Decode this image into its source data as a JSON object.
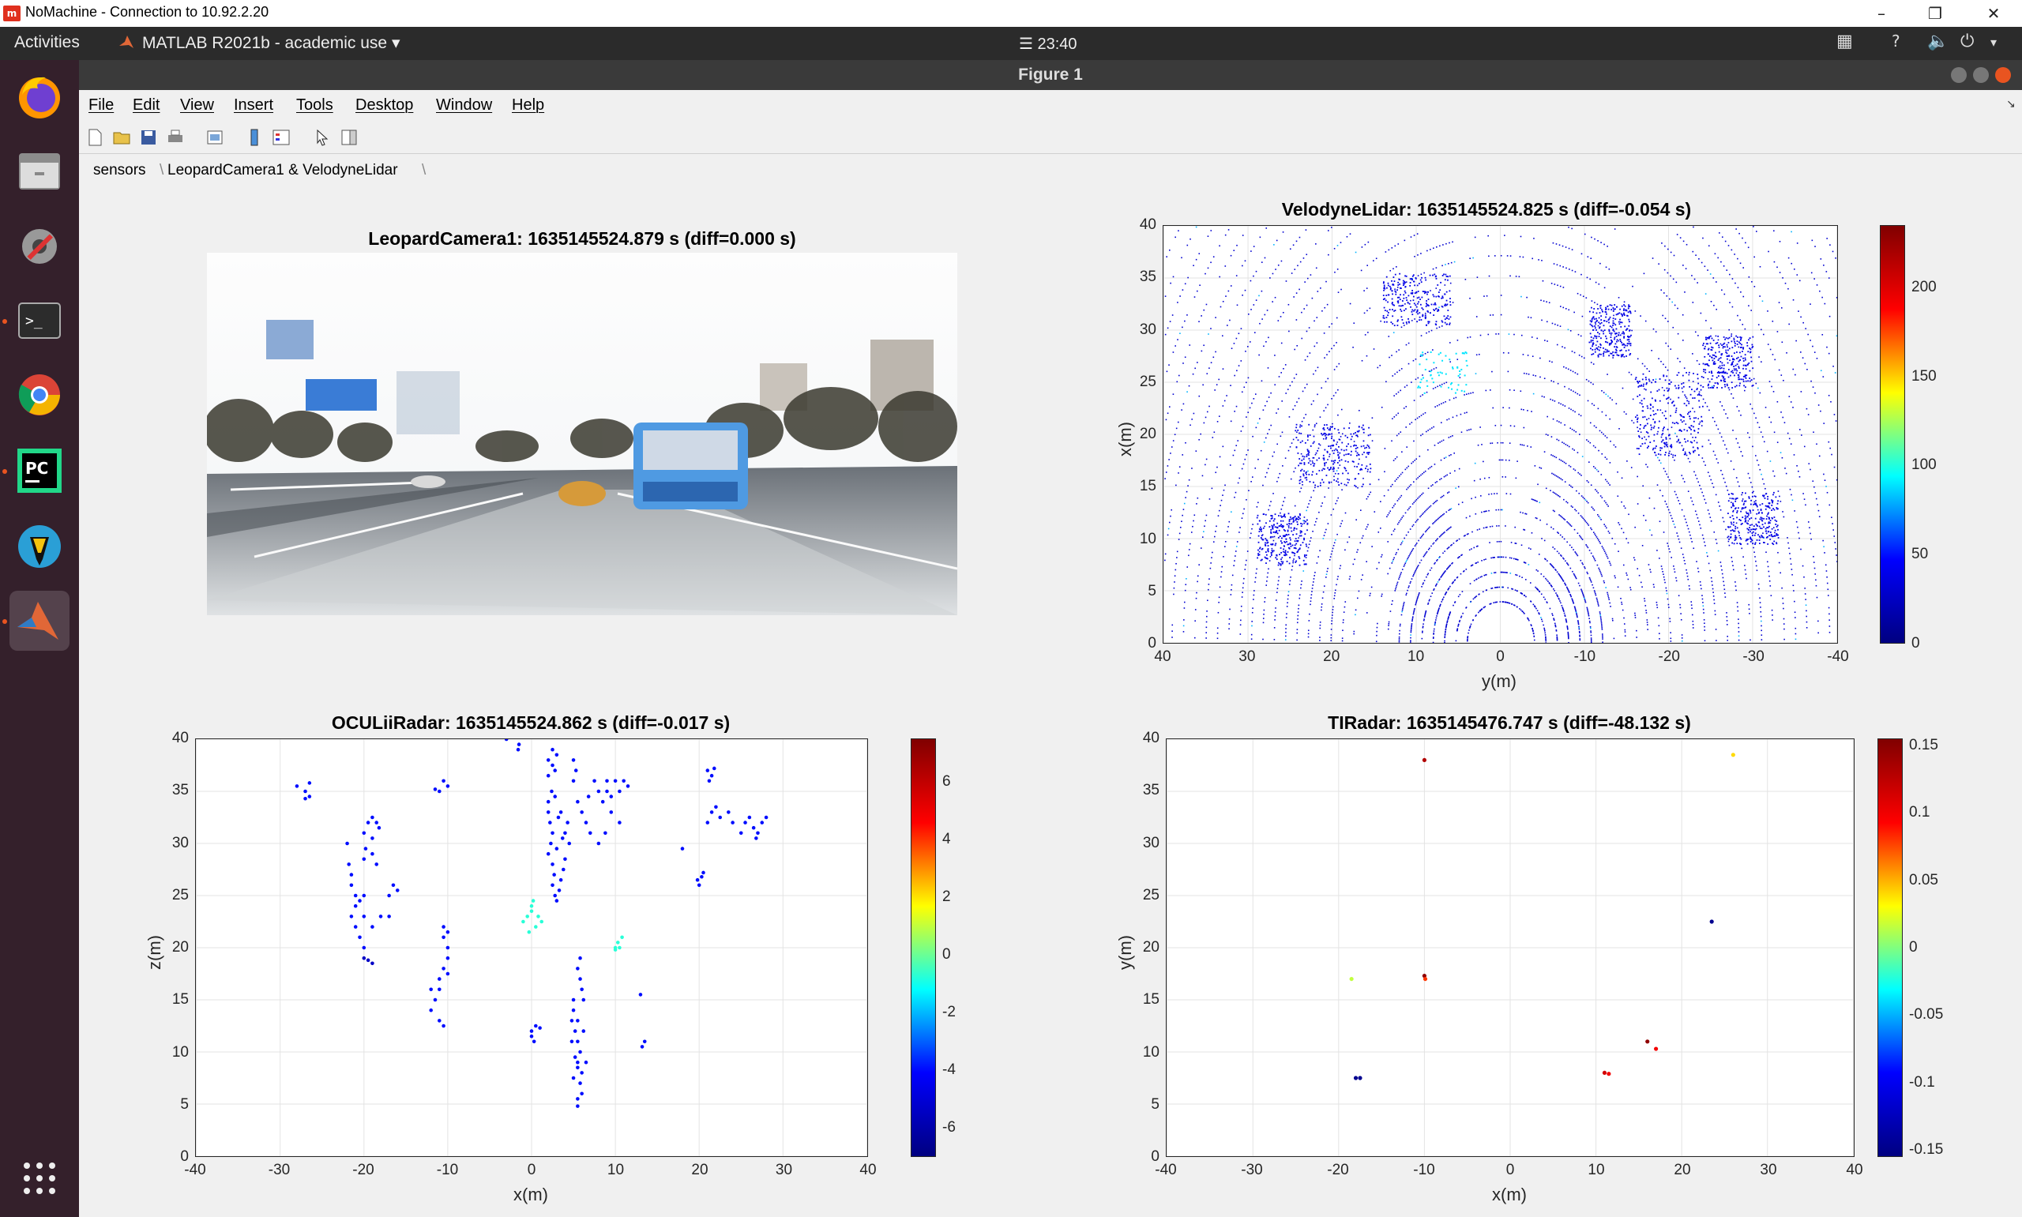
{
  "window": {
    "title": "NoMachine - Connection to 10.92.2.20",
    "logo": "m"
  },
  "topbar": {
    "activities": "Activities",
    "app_menu": "MATLAB R2021b - academic use",
    "clock": "☰ 23:40"
  },
  "figure": {
    "title": "Figure 1"
  },
  "menu": {
    "file": "File",
    "edit": "Edit",
    "view": "View",
    "insert": "Insert",
    "tools": "Tools",
    "desktop": "Desktop",
    "window": "Window",
    "help": "Help"
  },
  "tabs": [
    {
      "label": "sensors"
    },
    {
      "label": "LeopardCamera1 & VelodyneLidar"
    }
  ],
  "dock": [
    "firefox-icon",
    "files-icon",
    "settings-icon",
    "terminal-icon",
    "chrome-icon",
    "pycharm-icon",
    "ros-turtle-icon",
    "matlab-icon",
    "apps-grid-icon"
  ],
  "colormap": "jet",
  "chart_data": [
    {
      "type": "image",
      "title": "LeopardCamera1: 1635145524.879 s (diff=0.000 s)"
    },
    {
      "type": "scatter",
      "title": "VelodyneLidar: 1635145524.825 s (diff=-0.054 s)",
      "xlabel": "y(m)",
      "ylabel": "x(m)",
      "xlim": [
        40,
        -40
      ],
      "ylim": [
        0,
        40
      ],
      "xticks": [
        40,
        30,
        20,
        10,
        0,
        -10,
        -20,
        -30,
        -40
      ],
      "yticks": [
        0,
        5,
        10,
        15,
        20,
        25,
        30,
        35,
        40
      ],
      "colorbar": {
        "range": [
          0,
          235
        ],
        "ticks": [
          0,
          50,
          100,
          150,
          200
        ]
      },
      "grid": true
    },
    {
      "type": "scatter",
      "title": "OCULiiRadar: 1635145524.862 s (diff=-0.017 s)",
      "xlabel": "x(m)",
      "ylabel": "z(m)",
      "xlim": [
        -40,
        40
      ],
      "ylim": [
        0,
        40
      ],
      "xticks": [
        -40,
        -30,
        -20,
        -10,
        0,
        10,
        20,
        30,
        40
      ],
      "yticks": [
        0,
        5,
        10,
        15,
        20,
        25,
        30,
        35,
        40
      ],
      "colorbar": {
        "range": [
          -7,
          7.5
        ],
        "ticks": [
          -6,
          -4,
          -2,
          0,
          2,
          4,
          6
        ]
      },
      "grid": true,
      "points": [
        [
          -28,
          35.5,
          -5
        ],
        [
          -27,
          35,
          -5
        ],
        [
          -26.5,
          34.5,
          -5
        ],
        [
          -26.5,
          35.8,
          -5
        ],
        [
          -27,
          34.3,
          -5
        ],
        [
          -22,
          30,
          -5
        ],
        [
          -21.8,
          28,
          -5
        ],
        [
          -21.5,
          27,
          -5
        ],
        [
          -21.5,
          26,
          -5
        ],
        [
          -21,
          25,
          -5
        ],
        [
          -21,
          24,
          -5
        ],
        [
          -21.5,
          23,
          -5
        ],
        [
          -20.5,
          24.5,
          -5
        ],
        [
          -20,
          25,
          -5
        ],
        [
          -21,
          22,
          -5
        ],
        [
          -20.5,
          21,
          -5
        ],
        [
          -20,
          20,
          -5
        ],
        [
          -20,
          19,
          -6
        ],
        [
          -19.5,
          18.8,
          -6
        ],
        [
          -19,
          18.5,
          -6
        ],
        [
          -20,
          31,
          -5
        ],
        [
          -19.5,
          32,
          -5
        ],
        [
          -19,
          32.5,
          -5
        ],
        [
          -18.5,
          32,
          -5
        ],
        [
          -18.2,
          31.5,
          -5
        ],
        [
          -19,
          30.5,
          -5
        ],
        [
          -19.8,
          29.5,
          -5
        ],
        [
          -20,
          28.5,
          -5
        ],
        [
          -19,
          29,
          -5
        ],
        [
          -18.5,
          28,
          -5
        ],
        [
          -17,
          25,
          -5
        ],
        [
          -16.5,
          26,
          -5
        ],
        [
          -16,
          25.5,
          -5
        ],
        [
          -18,
          23,
          -5
        ],
        [
          -19,
          22,
          -5
        ],
        [
          -20,
          23,
          -5
        ],
        [
          -17,
          23,
          -5
        ],
        [
          -11,
          35,
          -5
        ],
        [
          -10.5,
          36,
          -5
        ],
        [
          -10,
          35.5,
          -5
        ],
        [
          -11.5,
          35.2,
          -5
        ],
        [
          -10.5,
          22,
          -5
        ],
        [
          -10.5,
          21,
          -5
        ],
        [
          -10,
          20,
          -5
        ],
        [
          -10,
          19,
          -5
        ],
        [
          -10.5,
          18,
          -5
        ],
        [
          -11,
          17,
          -5
        ],
        [
          -11,
          16,
          -5
        ],
        [
          -11.5,
          15,
          -5
        ],
        [
          -12,
          14,
          -5
        ],
        [
          -11,
          13,
          -5
        ],
        [
          -10.5,
          12.5,
          -5
        ],
        [
          -12,
          16,
          -5
        ],
        [
          -10,
          17.5,
          -5
        ],
        [
          -10,
          21.5,
          -5
        ],
        [
          -3,
          40,
          -5
        ],
        [
          -1.5,
          39.5,
          -5
        ],
        [
          -1.6,
          39,
          -5
        ],
        [
          0,
          12,
          -5
        ],
        [
          0,
          11.5,
          -5
        ],
        [
          0.3,
          11,
          -5
        ],
        [
          1,
          12.3,
          -5
        ],
        [
          0.5,
          12.5,
          -5
        ],
        [
          -1,
          22.5,
          -1
        ],
        [
          -0.5,
          23,
          -1
        ],
        [
          0,
          24,
          -1
        ],
        [
          0,
          23.5,
          -1
        ],
        [
          0.5,
          22,
          -1
        ],
        [
          -0.3,
          21.5,
          -1
        ],
        [
          0.2,
          24.5,
          -1
        ],
        [
          0.8,
          23,
          -1
        ],
        [
          1.2,
          22.5,
          -1
        ],
        [
          2,
          38,
          -5
        ],
        [
          2.5,
          37.5,
          -5
        ],
        [
          2.8,
          37,
          -5
        ],
        [
          2,
          36.5,
          -5
        ],
        [
          2.5,
          39,
          -5
        ],
        [
          3,
          38.5,
          -5
        ],
        [
          2,
          34,
          -5
        ],
        [
          2,
          33,
          -5
        ],
        [
          2.2,
          32,
          -5
        ],
        [
          2.5,
          31,
          -5
        ],
        [
          2.3,
          30,
          -5
        ],
        [
          2,
          29,
          -5
        ],
        [
          2.5,
          28,
          -5
        ],
        [
          2.7,
          27,
          -5
        ],
        [
          2.5,
          26,
          -5
        ],
        [
          2.8,
          25,
          -5
        ],
        [
          3,
          24.5,
          -5
        ],
        [
          3.3,
          25.5,
          -5
        ],
        [
          3.5,
          26.5,
          -5
        ],
        [
          3.8,
          27.5,
          -5
        ],
        [
          4,
          28.5,
          -5
        ],
        [
          3.7,
          30.5,
          -5
        ],
        [
          4,
          31,
          -5
        ],
        [
          4.3,
          32,
          -5
        ],
        [
          3.5,
          33,
          -5
        ],
        [
          2.8,
          34.5,
          -5
        ],
        [
          2.4,
          35,
          -5
        ],
        [
          4.5,
          30,
          -5
        ],
        [
          3,
          29.5,
          -5
        ],
        [
          3.2,
          32.5,
          -5
        ],
        [
          5,
          38,
          -5
        ],
        [
          5.3,
          37,
          -5
        ],
        [
          5,
          36,
          -5
        ],
        [
          5.5,
          34,
          -5
        ],
        [
          6,
          33,
          -5
        ],
        [
          6.5,
          32,
          -5
        ],
        [
          7,
          31,
          -5
        ],
        [
          6.8,
          34.5,
          -5
        ],
        [
          7.5,
          36,
          -5
        ],
        [
          8,
          35,
          -5
        ],
        [
          8.5,
          34,
          -5
        ],
        [
          9,
          35,
          -5
        ],
        [
          9.5,
          34.5,
          -5
        ],
        [
          10,
          36,
          -5
        ],
        [
          9,
          36,
          -5
        ],
        [
          10.5,
          35,
          -5
        ],
        [
          11,
          36,
          -5
        ],
        [
          11.5,
          35.5,
          -5
        ],
        [
          10.5,
          32,
          -5
        ],
        [
          9.5,
          33,
          -5
        ],
        [
          8.8,
          31,
          -5
        ],
        [
          8,
          30,
          -5
        ],
        [
          5,
          15,
          -5
        ],
        [
          5,
          14,
          -5
        ],
        [
          5.5,
          13,
          -5
        ],
        [
          5.2,
          12,
          -5
        ],
        [
          5.5,
          11,
          -5
        ],
        [
          5.8,
          10,
          -5
        ],
        [
          5.5,
          9,
          -5
        ],
        [
          6,
          8,
          -5
        ],
        [
          5.8,
          7,
          -5
        ],
        [
          6,
          6,
          -5
        ],
        [
          5.5,
          5.5,
          -5
        ],
        [
          5,
          7.5,
          -5
        ],
        [
          5.2,
          9.5,
          -5
        ],
        [
          4.8,
          11,
          -5
        ],
        [
          6.2,
          12,
          -5
        ],
        [
          6.2,
          15,
          -5
        ],
        [
          6,
          16,
          -5
        ],
        [
          5.8,
          17,
          -5
        ],
        [
          5.5,
          18,
          -5
        ],
        [
          5.8,
          19,
          -5
        ],
        [
          5.5,
          8.5,
          -5
        ],
        [
          6.5,
          9,
          -5
        ],
        [
          4.8,
          13,
          -5
        ],
        [
          5.5,
          4.8,
          -5
        ],
        [
          10,
          20,
          -1
        ],
        [
          10.3,
          20.5,
          -1
        ],
        [
          10.8,
          21,
          -1
        ],
        [
          10.5,
          20,
          -1
        ],
        [
          10,
          19.8,
          -1
        ],
        [
          13,
          15.5,
          -5
        ],
        [
          13.5,
          11,
          -5
        ],
        [
          13.2,
          10.5,
          -5
        ],
        [
          18,
          29.5,
          -5
        ],
        [
          20,
          26,
          -5
        ],
        [
          20.3,
          26.8,
          -5
        ],
        [
          20.5,
          27.2,
          -5
        ],
        [
          19.8,
          26.5,
          -5
        ],
        [
          21,
          37,
          -5
        ],
        [
          21.5,
          36.5,
          -5
        ],
        [
          21.8,
          37.2,
          -5
        ],
        [
          21.2,
          36,
          -5
        ],
        [
          21,
          32,
          -5
        ],
        [
          21.5,
          33,
          -5
        ],
        [
          22,
          33.5,
          -5
        ],
        [
          22.5,
          32.5,
          -5
        ],
        [
          23.5,
          33,
          -5
        ],
        [
          24,
          32,
          -5
        ],
        [
          25,
          31,
          -5
        ],
        [
          25.5,
          32,
          -5
        ],
        [
          26,
          32.5,
          -5
        ],
        [
          26.5,
          31.5,
          -5
        ],
        [
          27,
          31,
          -5
        ],
        [
          27.5,
          32,
          -5
        ],
        [
          28,
          32.5,
          -5
        ],
        [
          26.8,
          30.5,
          -5
        ]
      ]
    },
    {
      "type": "scatter",
      "title": "TIRadar: 1635145476.747 s (diff=-48.132 s)",
      "xlabel": "x(m)",
      "ylabel": "y(m)",
      "xlim": [
        -40,
        40
      ],
      "ylim": [
        0,
        40
      ],
      "xticks": [
        -40,
        -30,
        -20,
        -10,
        0,
        10,
        20,
        30,
        40
      ],
      "yticks": [
        0,
        5,
        10,
        15,
        20,
        25,
        30,
        35,
        40
      ],
      "colorbar": {
        "range": [
          -0.155,
          0.155
        ],
        "ticks": [
          -0.15,
          -0.1,
          -0.05,
          0,
          0.05,
          0.1,
          0.15
        ]
      },
      "colorbar_labels": [
        "-0.15",
        "-0.1",
        "-0.05",
        "0",
        "0.05",
        "0.1",
        "0.15"
      ],
      "grid": true,
      "points": [
        [
          -10,
          38,
          0.14
        ],
        [
          -18.5,
          17,
          0.02
        ],
        [
          -10,
          17.3,
          0.15
        ],
        [
          -9.9,
          17,
          0.1
        ],
        [
          -18,
          7.5,
          -0.15
        ],
        [
          -17.5,
          7.5,
          -0.15
        ],
        [
          23.5,
          22.5,
          -0.15
        ],
        [
          16,
          11,
          0.15
        ],
        [
          17,
          10.3,
          0.12
        ],
        [
          11,
          8,
          0.13
        ],
        [
          11.5,
          7.9,
          0.12
        ],
        [
          26,
          38.5,
          0.05
        ]
      ]
    }
  ]
}
